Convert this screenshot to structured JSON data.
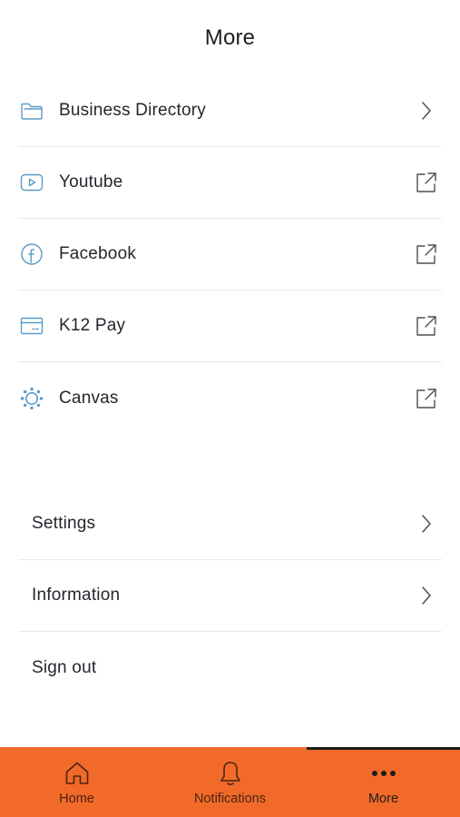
{
  "header": {
    "title": "More"
  },
  "links": [
    {
      "label": "Business Directory",
      "icon": "folder-icon",
      "trailing": "chevron-right-icon"
    },
    {
      "label": "Youtube",
      "icon": "youtube-icon",
      "trailing": "external-link-icon"
    },
    {
      "label": "Facebook",
      "icon": "facebook-icon",
      "trailing": "external-link-icon"
    },
    {
      "label": "K12 Pay",
      "icon": "credit-card-icon",
      "trailing": "external-link-icon"
    },
    {
      "label": "Canvas",
      "icon": "canvas-icon",
      "trailing": "external-link-icon"
    }
  ],
  "settings": [
    {
      "label": "Settings",
      "trailing": "chevron-right-icon"
    },
    {
      "label": "Information",
      "trailing": "chevron-right-icon"
    },
    {
      "label": "Sign out"
    }
  ],
  "tabbar": {
    "items": [
      {
        "label": "Home",
        "icon": "home-icon"
      },
      {
        "label": "Notifications",
        "icon": "bell-icon"
      },
      {
        "label": "More",
        "icon": "more-dots-icon",
        "active": true
      }
    ]
  },
  "colors": {
    "accent": "#f26a2a",
    "icon_blue": "#5b9bc6",
    "divider": "#e7e9ee",
    "text": "#23272d"
  }
}
